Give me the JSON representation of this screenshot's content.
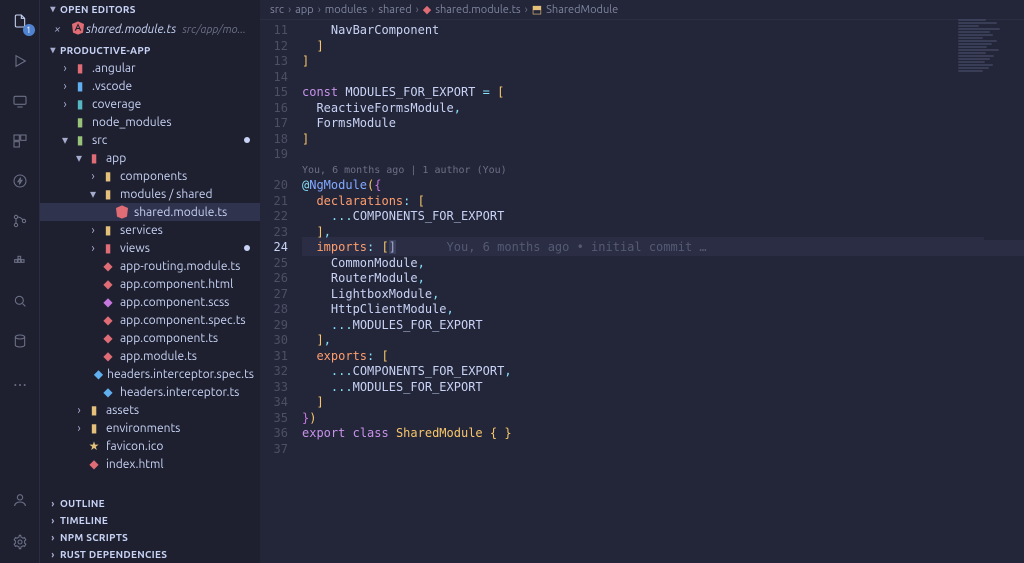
{
  "activity_badge": "1",
  "sections": {
    "open_editors": "OPEN EDITORS",
    "project": "PRODUCTIVE-APP",
    "outline": "OUTLINE",
    "timeline": "TIMELINE",
    "npm": "NPM SCRIPTS",
    "rust": "RUST DEPENDENCIES"
  },
  "open_editor": {
    "filename": "shared.module.ts",
    "path": "src/app/mo..."
  },
  "tree": {
    "angular": ".angular",
    "vscode": ".vscode",
    "coverage": "coverage",
    "node_modules": "node_modules",
    "src": "src",
    "app": "app",
    "components": "components",
    "modules_shared": "modules / shared",
    "shared_module": "shared.module.ts",
    "services": "services",
    "views": "views",
    "app_routing": "app-routing.module.ts",
    "app_html": "app.component.html",
    "app_scss": "app.component.scss",
    "app_spec": "app.component.spec.ts",
    "app_ts": "app.component.ts",
    "app_module": "app.module.ts",
    "headers_spec": "headers.interceptor.spec.ts",
    "headers": "headers.interceptor.ts",
    "assets": "assets",
    "environments": "environments",
    "favicon": "favicon.ico",
    "index": "index.html"
  },
  "breadcrumb": {
    "p0": "src",
    "p1": "app",
    "p2": "modules",
    "p3": "shared",
    "p4": "shared.module.ts",
    "p5": "SharedModule"
  },
  "code": {
    "l11": "    NavBarComponent",
    "lens": "You, 6 months ago | 1 author (You)",
    "ghost": "You, 6 months ago • initial commit …",
    "const_kw": "const",
    "mfe": "MODULES_FOR_EXPORT",
    "cfe": "COMPONENTS_FOR_EXPORT",
    "rfm": "ReactiveFormsModule",
    "fm": "FormsModule",
    "ngm": "NgModule",
    "decl": "declarations",
    "imports": "imports",
    "exports_p": "exports",
    "common": "CommonModule",
    "router": "RouterModule",
    "lightbox": "LightboxModule",
    "http": "HttpClientModule",
    "export_kw": "export",
    "class_kw": "class",
    "shared_cls": "SharedModule"
  },
  "line_numbers": [
    "11",
    "12",
    "13",
    "14",
    "15",
    "16",
    "17",
    "18",
    "19",
    "20",
    "21",
    "22",
    "23",
    "24",
    "25",
    "26",
    "27",
    "28",
    "29",
    "30",
    "31",
    "32",
    "33",
    "34",
    "35",
    "36",
    "37"
  ],
  "current_line": "24"
}
